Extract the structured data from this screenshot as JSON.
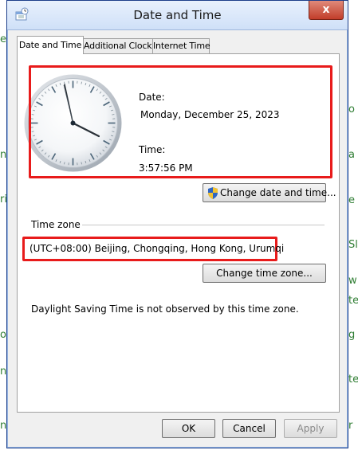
{
  "window": {
    "title": "Date and Time",
    "close_glyph": "x",
    "icon": "date-time-icon"
  },
  "tabs": [
    {
      "label": "Date and Time",
      "active": true
    },
    {
      "label": "Additional Clocks",
      "active": false
    },
    {
      "label": "Internet Time",
      "active": false
    }
  ],
  "date_section": {
    "date_label": "Date:",
    "date_value": "Monday, December 25, 2023",
    "time_label": "Time:",
    "time_value": "3:57:56 PM",
    "change_button": "Change date and time...",
    "change_button_icon": "uac-shield-icon"
  },
  "timezone_section": {
    "group_label": "Time zone",
    "value": "(UTC+08:00) Beijing, Chongqing, Hong Kong, Urumqi",
    "change_button": "Change time zone..."
  },
  "dst_note": "Daylight Saving Time is not observed by this time zone.",
  "footer": {
    "ok": "OK",
    "cancel": "Cancel",
    "apply": "Apply"
  },
  "background_fragments": {
    "left": [
      "er",
      "n",
      "ri",
      "o",
      "n",
      "n"
    ],
    "right": [
      "o",
      "a",
      "e",
      "Sl",
      "w",
      "te",
      "g",
      "te",
      "r"
    ]
  },
  "colors": {
    "highlight_box": "#e81b1b",
    "background_text": "#2e7d32"
  }
}
